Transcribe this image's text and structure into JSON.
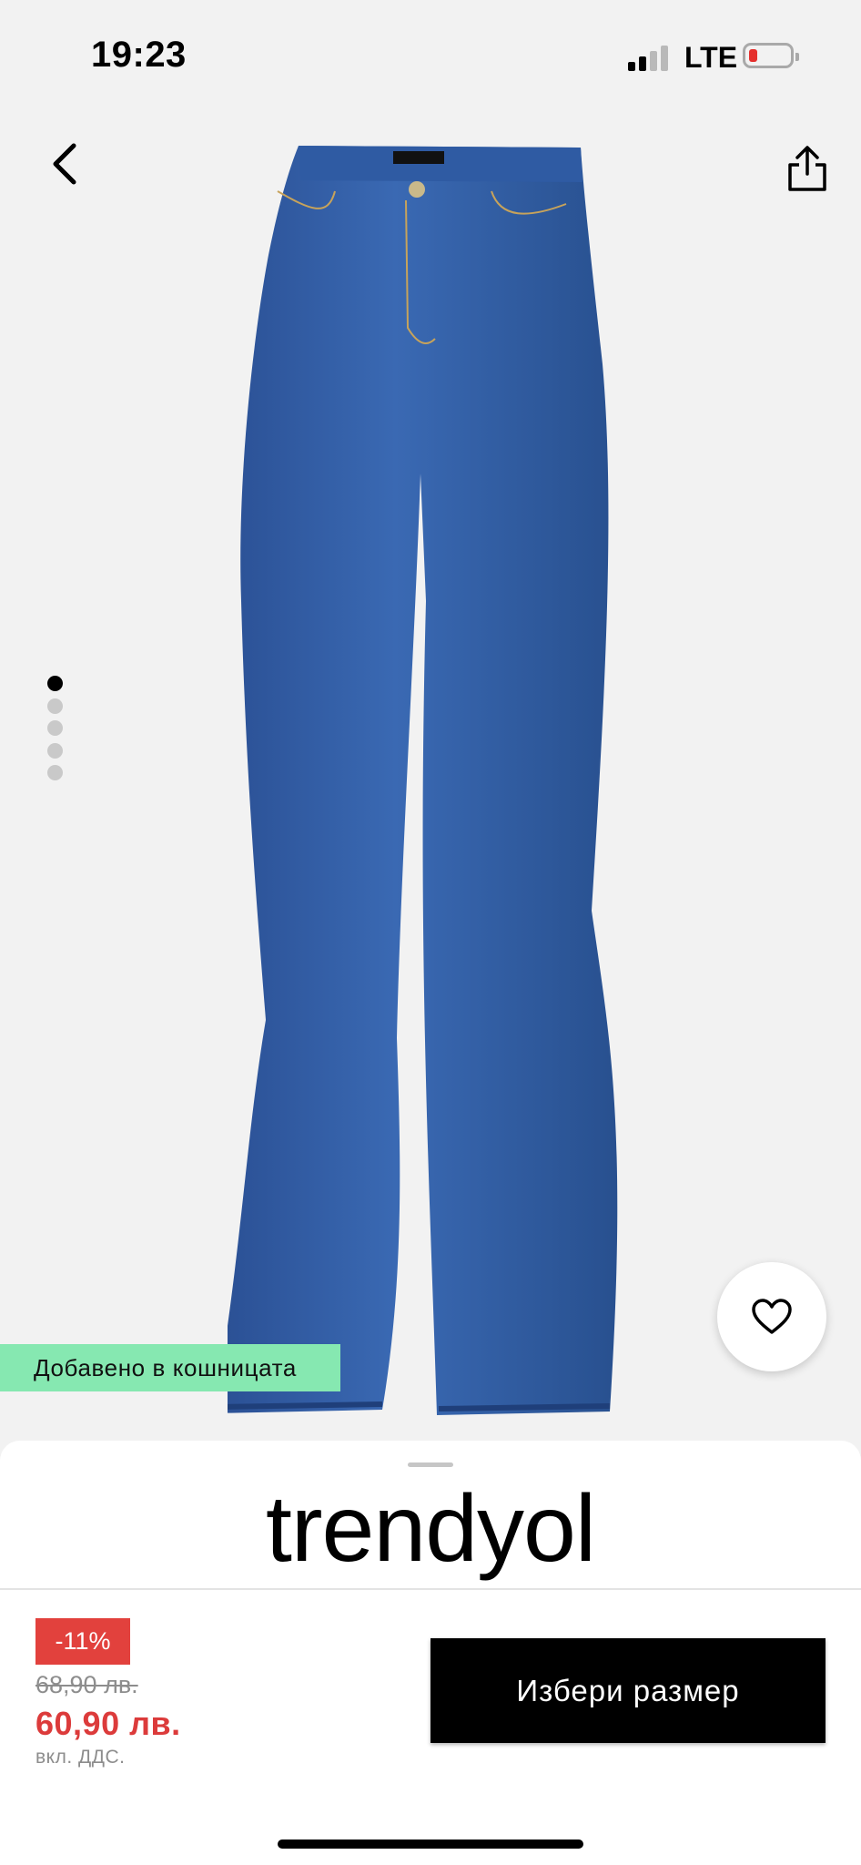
{
  "status_bar": {
    "time": "19:23",
    "network": "LTE",
    "icons": [
      "signal-icon",
      "battery-icon"
    ],
    "battery_color": "#e5302d"
  },
  "gallery": {
    "icons": {
      "back": "chevron-left-icon",
      "share": "share-icon",
      "favorite": "heart-icon"
    },
    "image_count": 5,
    "active_image": 1,
    "denim_color": "#2d5aa3"
  },
  "toast": {
    "text": "Добавено в кошницата",
    "color": "#86e8b1"
  },
  "product": {
    "brand": "trendyol",
    "discount": "-11%",
    "old_price": "68,90 лв.",
    "price": "60,90 лв.",
    "vat_note": "вкл. ДДС.",
    "price_color": "#dc3b3b"
  },
  "actions": {
    "select_size_label": "Избери размер"
  }
}
